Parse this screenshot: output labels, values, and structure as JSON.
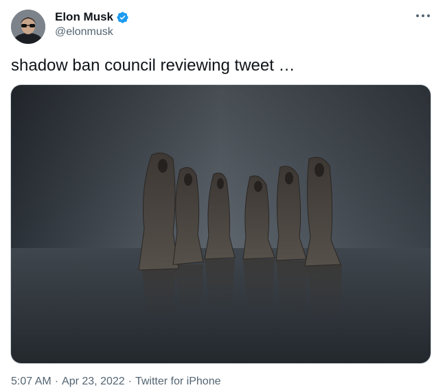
{
  "author": {
    "display_name": "Elon Musk",
    "handle": "@elonmusk",
    "verified": true,
    "verified_color": "#1d9bf0"
  },
  "tweet": {
    "text": "shadow ban council reviewing tweet …",
    "time": "5:07 AM",
    "separator": "·",
    "date": "Apr 23, 2022",
    "source": "Twitter for iPhone"
  },
  "icons": {
    "verified": "verified-badge-icon",
    "more": "more-options-icon"
  },
  "colors": {
    "text": "#0f1419",
    "secondary": "#536471",
    "background": "#ffffff"
  }
}
